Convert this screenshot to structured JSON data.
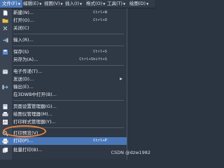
{
  "menubar": {
    "items": [
      "文件(F)",
      "编辑(E)",
      "视图(V)",
      "插入(I)",
      "格式(O)",
      "工具(T)",
      "绘图(D)"
    ]
  },
  "menu": {
    "new": {
      "label": "新建(N)...",
      "shortcut": "Ctrl+N"
    },
    "open": {
      "label": "打开(O)...",
      "shortcut": "Ctrl+O"
    },
    "close": {
      "label": "关闭(C)"
    },
    "import": {
      "label": "输入(R)..."
    },
    "save": {
      "label": "保存(S)",
      "shortcut": "Ctrl+S"
    },
    "saveas": {
      "label": "另存为(A)...",
      "shortcut": "Ctrl+Shift+S"
    },
    "etransmit": {
      "label": "电子传递(T)..."
    },
    "publish": {
      "label": "发送(D)..."
    },
    "export": {
      "label": "输出(E)..."
    },
    "open3dwb": {
      "label": "在3DWB中打开(B)..."
    },
    "pagesetup": {
      "label": "页面设置管理器(G)..."
    },
    "plottermgr": {
      "label": "绘图仪管理器(M)..."
    },
    "plotstylemgr": {
      "label": "打印样式管理器(Y)..."
    },
    "plotpreview": {
      "label": "打印预览(V)"
    },
    "plot": {
      "label": "打印(P)...",
      "shortcut": "Ctrl+P"
    },
    "publish2": {
      "label": "批量打印(B)..."
    }
  },
  "watermark": "CSDN @dzw1982"
}
